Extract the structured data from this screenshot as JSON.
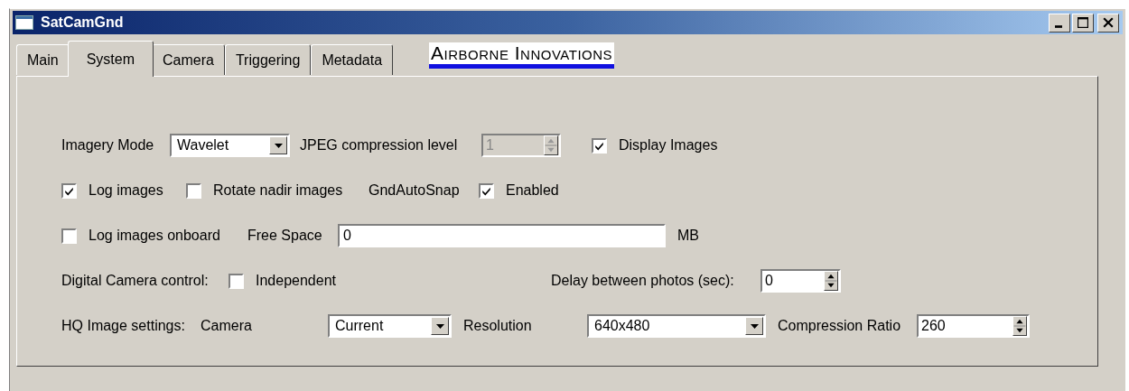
{
  "window": {
    "title": "SatCamGnd"
  },
  "tabs": [
    {
      "label": "Main",
      "selected": false
    },
    {
      "label": "System",
      "selected": true
    },
    {
      "label": "Camera",
      "selected": false
    },
    {
      "label": "Triggering",
      "selected": false
    },
    {
      "label": "Metadata",
      "selected": false
    }
  ],
  "logo": {
    "text": "Airborne Innovations"
  },
  "rows": [
    [
      {
        "kind": "label",
        "text": "Imagery Mode"
      },
      {
        "kind": "combo",
        "value": "Wavelet"
      },
      {
        "kind": "label",
        "text": "JPEG compression level"
      },
      {
        "kind": "spin",
        "value": "1",
        "disabled": true
      },
      {
        "kind": "checkbox",
        "label": "Display Images",
        "checked": true
      }
    ],
    [
      {
        "kind": "checkbox",
        "label": "Log images",
        "checked": true
      },
      {
        "kind": "checkbox",
        "label": "Rotate nadir images",
        "checked": false
      },
      {
        "kind": "label",
        "text": "GndAutoSnap"
      },
      {
        "kind": "checkbox",
        "label": "Enabled",
        "checked": true
      }
    ],
    [
      {
        "kind": "checkbox",
        "label": "Log images onboard",
        "checked": false
      },
      {
        "kind": "label",
        "text": "Free Space"
      },
      {
        "kind": "field",
        "value": "0"
      },
      {
        "kind": "label",
        "text": "MB"
      }
    ],
    [
      {
        "kind": "label",
        "text": "Digital Camera control:"
      },
      {
        "kind": "checkbox",
        "label": "Independent",
        "checked": false
      },
      {
        "kind": "label",
        "text": "Delay between photos (sec):"
      },
      {
        "kind": "spin",
        "value": "0",
        "disabled": false
      }
    ],
    [
      {
        "kind": "label",
        "text": "HQ Image settings:"
      },
      {
        "kind": "label",
        "text": "Camera"
      },
      {
        "kind": "combo",
        "value": "Current"
      },
      {
        "kind": "label",
        "text": "Resolution"
      },
      {
        "kind": "combo",
        "value": "640x480"
      },
      {
        "kind": "label",
        "text": "Compression Ratio"
      },
      {
        "kind": "spin",
        "value": "260",
        "disabled": false
      }
    ]
  ]
}
